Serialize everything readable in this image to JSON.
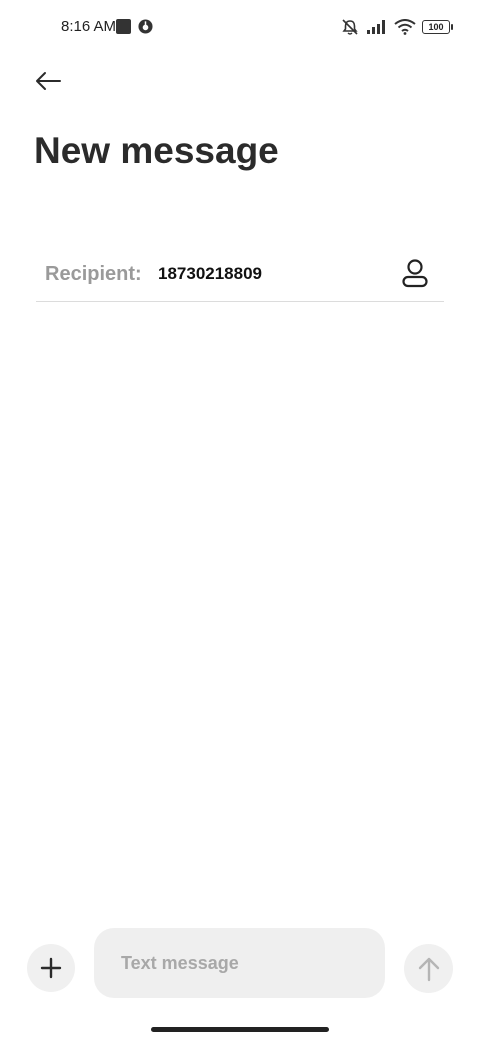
{
  "status_bar": {
    "time": "8:16 AM",
    "battery_level": "100",
    "icons": [
      "notification-square-icon",
      "app-status-icon",
      "mute-icon",
      "signal-icon",
      "wifi-icon",
      "battery-icon"
    ]
  },
  "header": {
    "back_icon": "arrow-left-icon",
    "title": "New message"
  },
  "recipient": {
    "label": "Recipient:",
    "value": "18730218809",
    "contact_icon": "person-icon"
  },
  "composer": {
    "add_icon": "plus-icon",
    "placeholder": "Text message",
    "send_icon": "arrow-up-icon"
  },
  "colors": {
    "background": "#ffffff",
    "text": "#2b2b2b",
    "muted_text": "#9a9a9a",
    "field_bg": "#efefef",
    "divider": "#dcdcdc"
  }
}
